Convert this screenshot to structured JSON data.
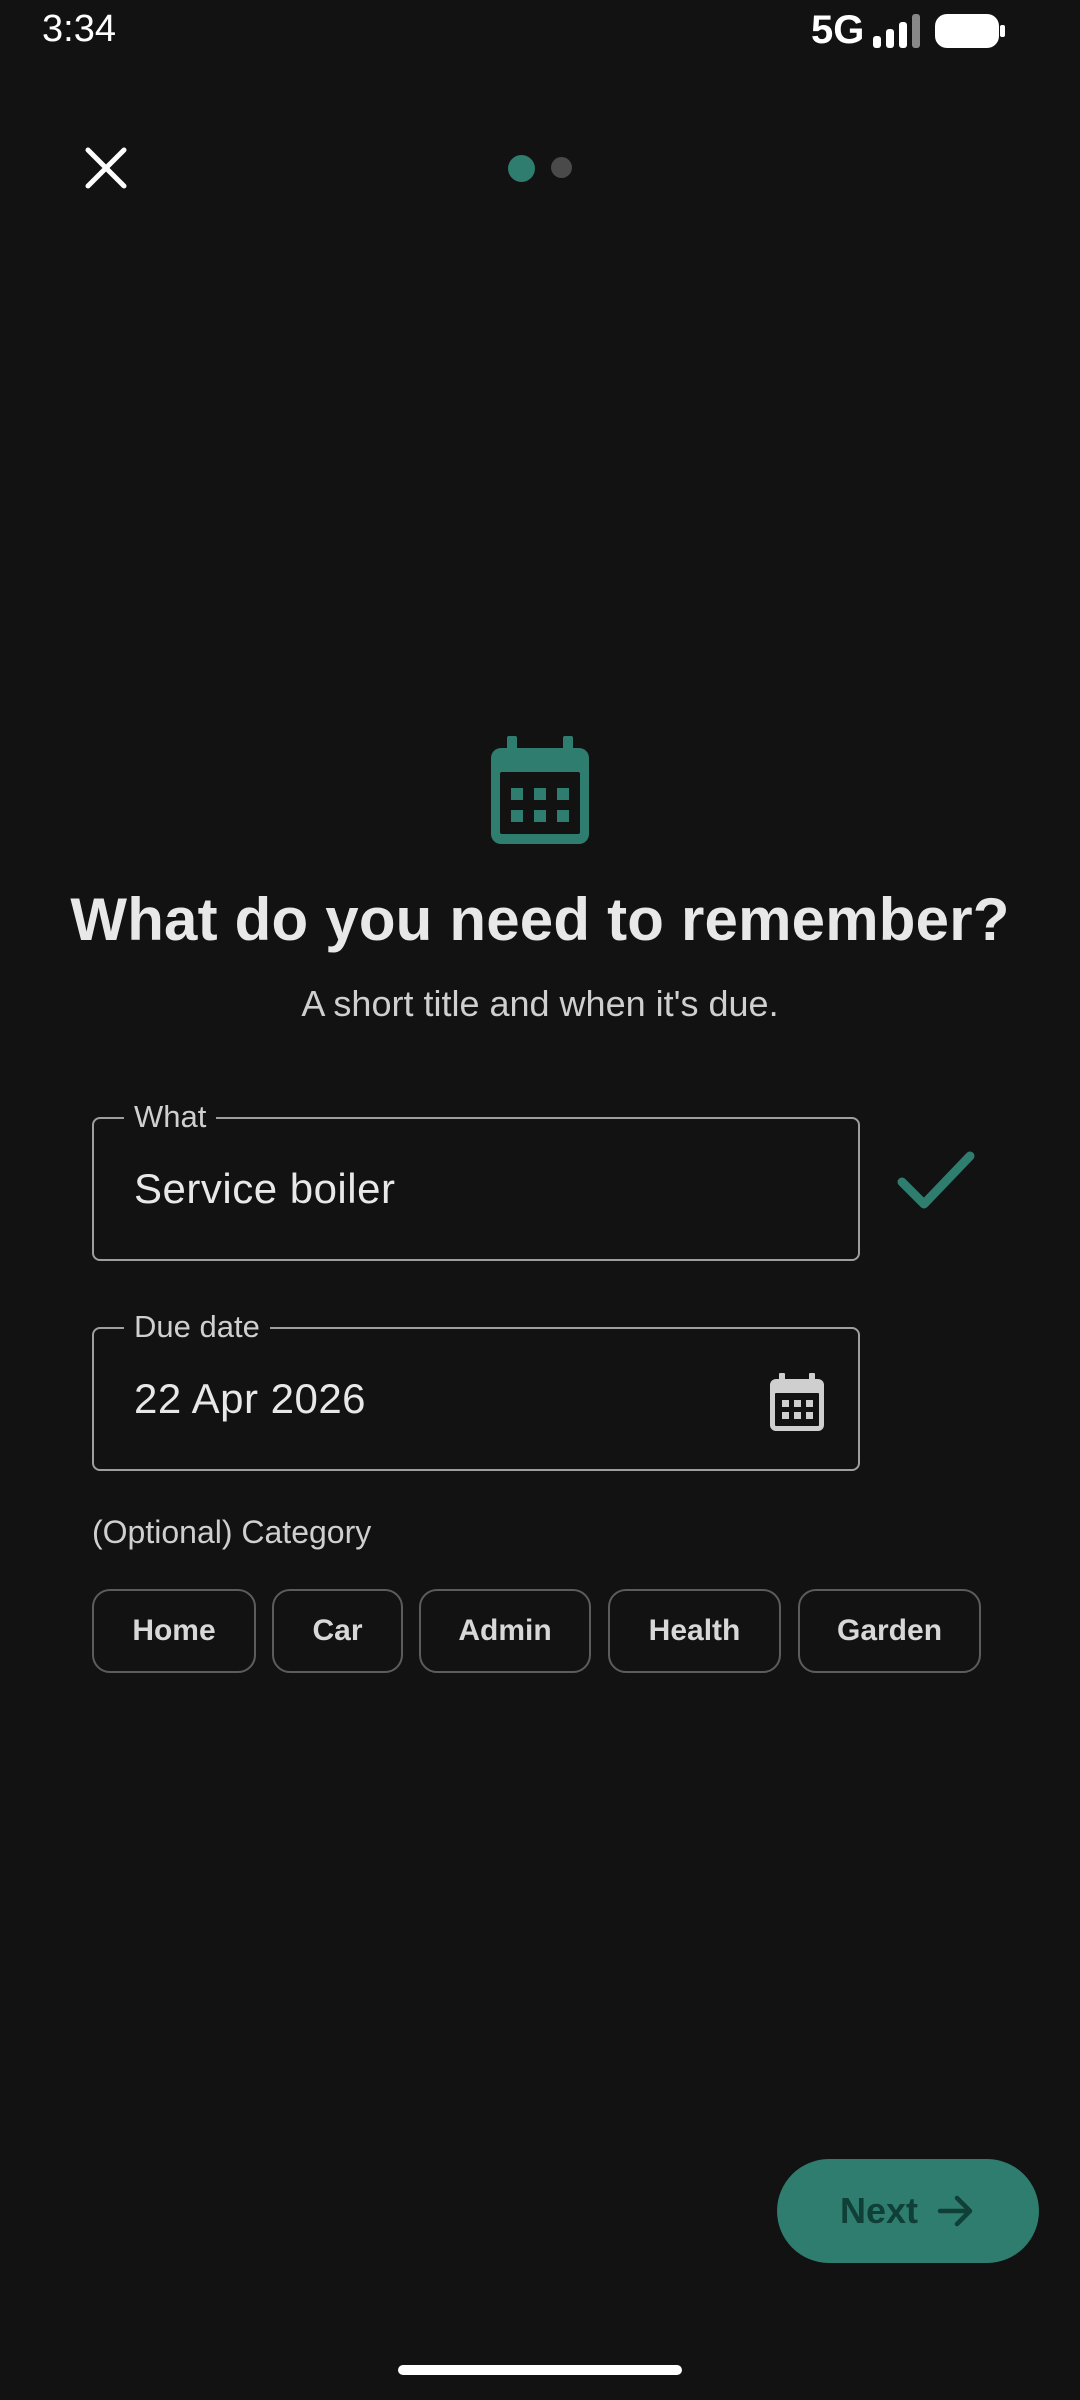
{
  "status_bar": {
    "time": "3:34",
    "network": "5G"
  },
  "stepper": {
    "current_step": 1,
    "total_steps": 2
  },
  "hero": {
    "icon": "calendar-icon",
    "title": "What do you need to remember?",
    "subtitle": "A short title and when it's due."
  },
  "form": {
    "what": {
      "label": "What",
      "value": "Service boiler",
      "valid": true
    },
    "due_date": {
      "label": "Due date",
      "value": "22 Apr 2026"
    },
    "category": {
      "label": "(Optional) Category",
      "options": [
        "Home",
        "Car",
        "Admin",
        "Health",
        "Garden"
      ]
    }
  },
  "actions": {
    "next_label": "Next"
  },
  "colors": {
    "accent": "#2e7d6e",
    "background": "#121212"
  }
}
